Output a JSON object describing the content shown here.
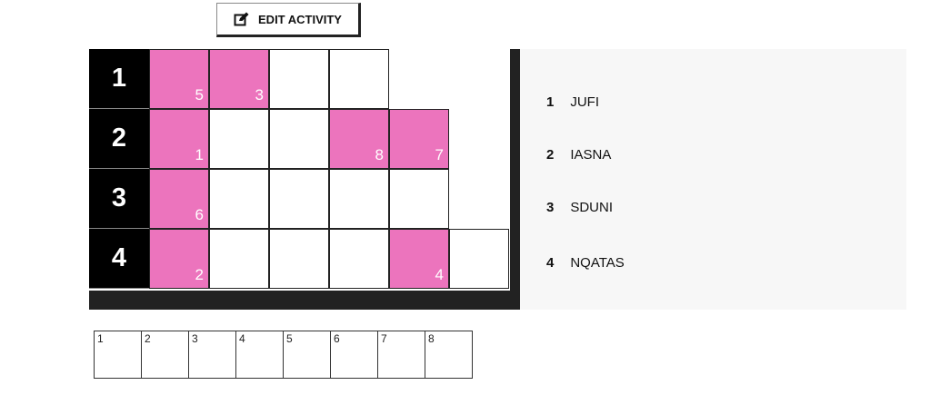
{
  "toolbar": {
    "edit_label": "EDIT ACTIVITY"
  },
  "puzzle": {
    "rows": [
      {
        "label": "1",
        "cells": [
          {
            "filled": true,
            "number": "5"
          },
          {
            "filled": true,
            "number": "3"
          },
          {
            "filled": false,
            "number": ""
          },
          {
            "filled": false,
            "number": ""
          }
        ]
      },
      {
        "label": "2",
        "cells": [
          {
            "filled": true,
            "number": "1"
          },
          {
            "filled": false,
            "number": ""
          },
          {
            "filled": false,
            "number": ""
          },
          {
            "filled": true,
            "number": "8"
          },
          {
            "filled": true,
            "number": "7"
          }
        ]
      },
      {
        "label": "3",
        "cells": [
          {
            "filled": true,
            "number": "6"
          },
          {
            "filled": false,
            "number": ""
          },
          {
            "filled": false,
            "number": ""
          },
          {
            "filled": false,
            "number": ""
          },
          {
            "filled": false,
            "number": ""
          }
        ]
      },
      {
        "label": "4",
        "cells": [
          {
            "filled": true,
            "number": "2"
          },
          {
            "filled": false,
            "number": ""
          },
          {
            "filled": false,
            "number": ""
          },
          {
            "filled": false,
            "number": ""
          },
          {
            "filled": true,
            "number": "4"
          },
          {
            "filled": false,
            "number": ""
          }
        ]
      }
    ],
    "highlight_color": "#ec74bd"
  },
  "clues": [
    {
      "number": "1",
      "text": "JUFI"
    },
    {
      "number": "2",
      "text": "IASNA"
    },
    {
      "number": "3",
      "text": "SDUNI"
    },
    {
      "number": "4",
      "text": "NQATAS"
    }
  ],
  "answer_boxes": [
    "1",
    "2",
    "3",
    "4",
    "5",
    "6",
    "7",
    "8"
  ]
}
